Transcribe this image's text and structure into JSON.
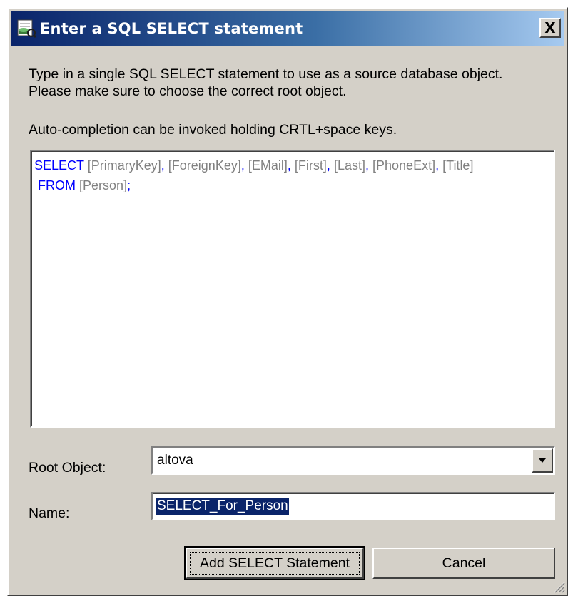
{
  "window": {
    "title": "Enter a SQL SELECT statement",
    "close_glyph": "X",
    "icon": "database-query-icon"
  },
  "instructions": {
    "line1": "Type in a single SQL SELECT statement to use as a source database object.",
    "line2": "Please make sure to choose the correct root object.",
    "line3": "Auto-completion can be invoked holding CRTL+space keys."
  },
  "sql": {
    "keyword_select": "SELECT",
    "columns": [
      "[PrimaryKey]",
      "[ForeignKey]",
      "[EMail]",
      "[First]",
      "[Last]",
      "[PhoneExt]",
      "[Title]"
    ],
    "separator": ",",
    "keyword_from": "FROM",
    "table": "[Person]",
    "terminator": ";",
    "colors": {
      "keyword": "#0000ff",
      "identifier": "#808080",
      "punctuation": "#0000ff"
    }
  },
  "root_object": {
    "label": "Root Object:",
    "value": "altova"
  },
  "name": {
    "label": "Name:",
    "value": "SELECT_For_Person"
  },
  "buttons": {
    "add": "Add SELECT Statement",
    "cancel": "Cancel"
  }
}
